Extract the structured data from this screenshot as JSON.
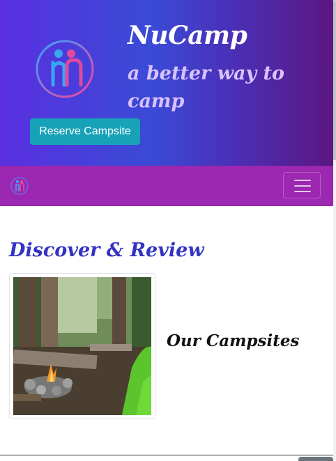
{
  "header": {
    "title": "NuCamp",
    "tagline": "a better way to camp",
    "reserve_label": "Reserve Campsite"
  },
  "navbar": {
    "logo": "nucamp-logo-icon",
    "toggle": "hamburger-menu-icon"
  },
  "main": {
    "section_title": "Discover & Review",
    "card_title": "Our Campsites",
    "image": "campsite-image"
  },
  "colors": {
    "header_gradient_start": "#5a2fe0",
    "header_gradient_end": "#5b1781",
    "navbar": "#9c27b0",
    "button": "#17a2b8",
    "section_title": "#3333c4"
  }
}
